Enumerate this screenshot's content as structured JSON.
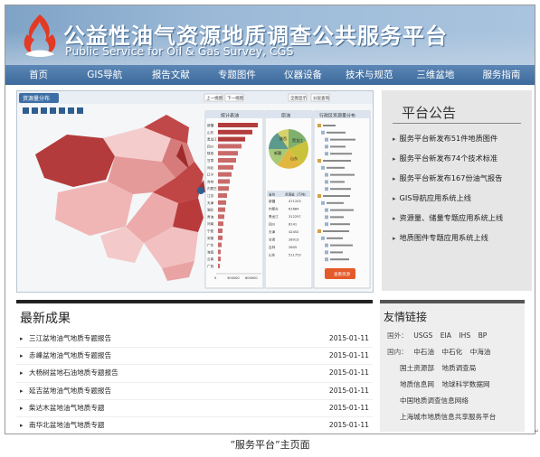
{
  "header": {
    "title_cn": "公益性油气资源地质调查公共服务平台",
    "title_en": "Public Service for Oil & Gas Survey, CGS",
    "logo_icon": "flame-logo-icon"
  },
  "nav": {
    "items": [
      "首页",
      "GIS导航",
      "报告文献",
      "专题图件",
      "仪器设备",
      "技术与规范",
      "三维盆地",
      "服务指南"
    ]
  },
  "hero": {
    "panel_tab": "资源量分布",
    "chart_panel_title": "统计表油",
    "pie_panel_title": "原油",
    "tree_panel_title": "行政区资源量分布",
    "provinces": [
      "新疆",
      "山东",
      "黑龙江",
      "四川",
      "陕西",
      "甘肃",
      "河北",
      "辽宁",
      "吉林",
      "内蒙古",
      "江苏",
      "天津",
      "湖北",
      "青海",
      "河南",
      "宁夏",
      "安徽",
      "广东",
      "海南",
      "云南",
      "广西"
    ],
    "table_head": [
      "省份",
      "资源量（万吨）"
    ],
    "table_rows": [
      [
        "新疆",
        "471203"
      ],
      [
        "内蒙古",
        "61684"
      ],
      [
        "黑龙江",
        "312257"
      ],
      [
        "四川",
        "8141"
      ],
      [
        "天津",
        "42452"
      ],
      [
        "甘肃",
        "28013"
      ],
      [
        "吉林",
        "2605"
      ],
      [
        "山东",
        "511753"
      ]
    ],
    "axis_ticks": [
      "0",
      "300000",
      "600000"
    ],
    "pie_labels": [
      "黑龙江",
      "新疆",
      "山东",
      "陕西"
    ],
    "button_label": "查看资源",
    "toolbar_buttons": [
      "上一视图",
      "下一视图",
      "全图显示",
      "分层查询"
    ]
  },
  "notice": {
    "title": "平台公告",
    "items": [
      "服务平台新发布51件地质图件",
      "服务平台新发布74个技术标准",
      "服务平台新发布167份油气报告",
      "GIS导航应用系统上线",
      "资源量、储量专题应用系统上线",
      "地质图件专题应用系统上线"
    ]
  },
  "latest": {
    "title": "最新成果",
    "items": [
      {
        "text": "三江盆地油气地质专题报告",
        "date": "2015-01-11"
      },
      {
        "text": "赤峰盆地油气地质专题报告",
        "date": "2015-01-11"
      },
      {
        "text": "大杨树盆地石油地质专题报告",
        "date": "2015-01-11"
      },
      {
        "text": "延吉盆地油气地质专题报告",
        "date": "2015-01-11"
      },
      {
        "text": "柴达木盆地油气地质专题",
        "date": "2015-01-11"
      },
      {
        "text": "南华北盆地油气地质专题",
        "date": "2015-01-11"
      }
    ]
  },
  "links": {
    "title": "友情链接",
    "foreign_label": "国外：",
    "foreign": [
      "USGS",
      "EIA",
      "IHS",
      "BP"
    ],
    "domestic_label": "国内：",
    "domestic": [
      "中石油",
      "中石化",
      "中海油"
    ],
    "rows": [
      [
        "国土资源部",
        "地质调查局"
      ],
      [
        "地质信息网",
        "地球科学数据网"
      ],
      [
        "中国地质调查信息网络"
      ],
      [
        "上海城市地质信息共享服务平台"
      ]
    ]
  },
  "caption": "“服务平台”主页面",
  "colors": {
    "nav": "#4a77a8",
    "banner": "#9cbad8",
    "map_dark": "#b83a3a",
    "map_light": "#f3c7c7"
  }
}
